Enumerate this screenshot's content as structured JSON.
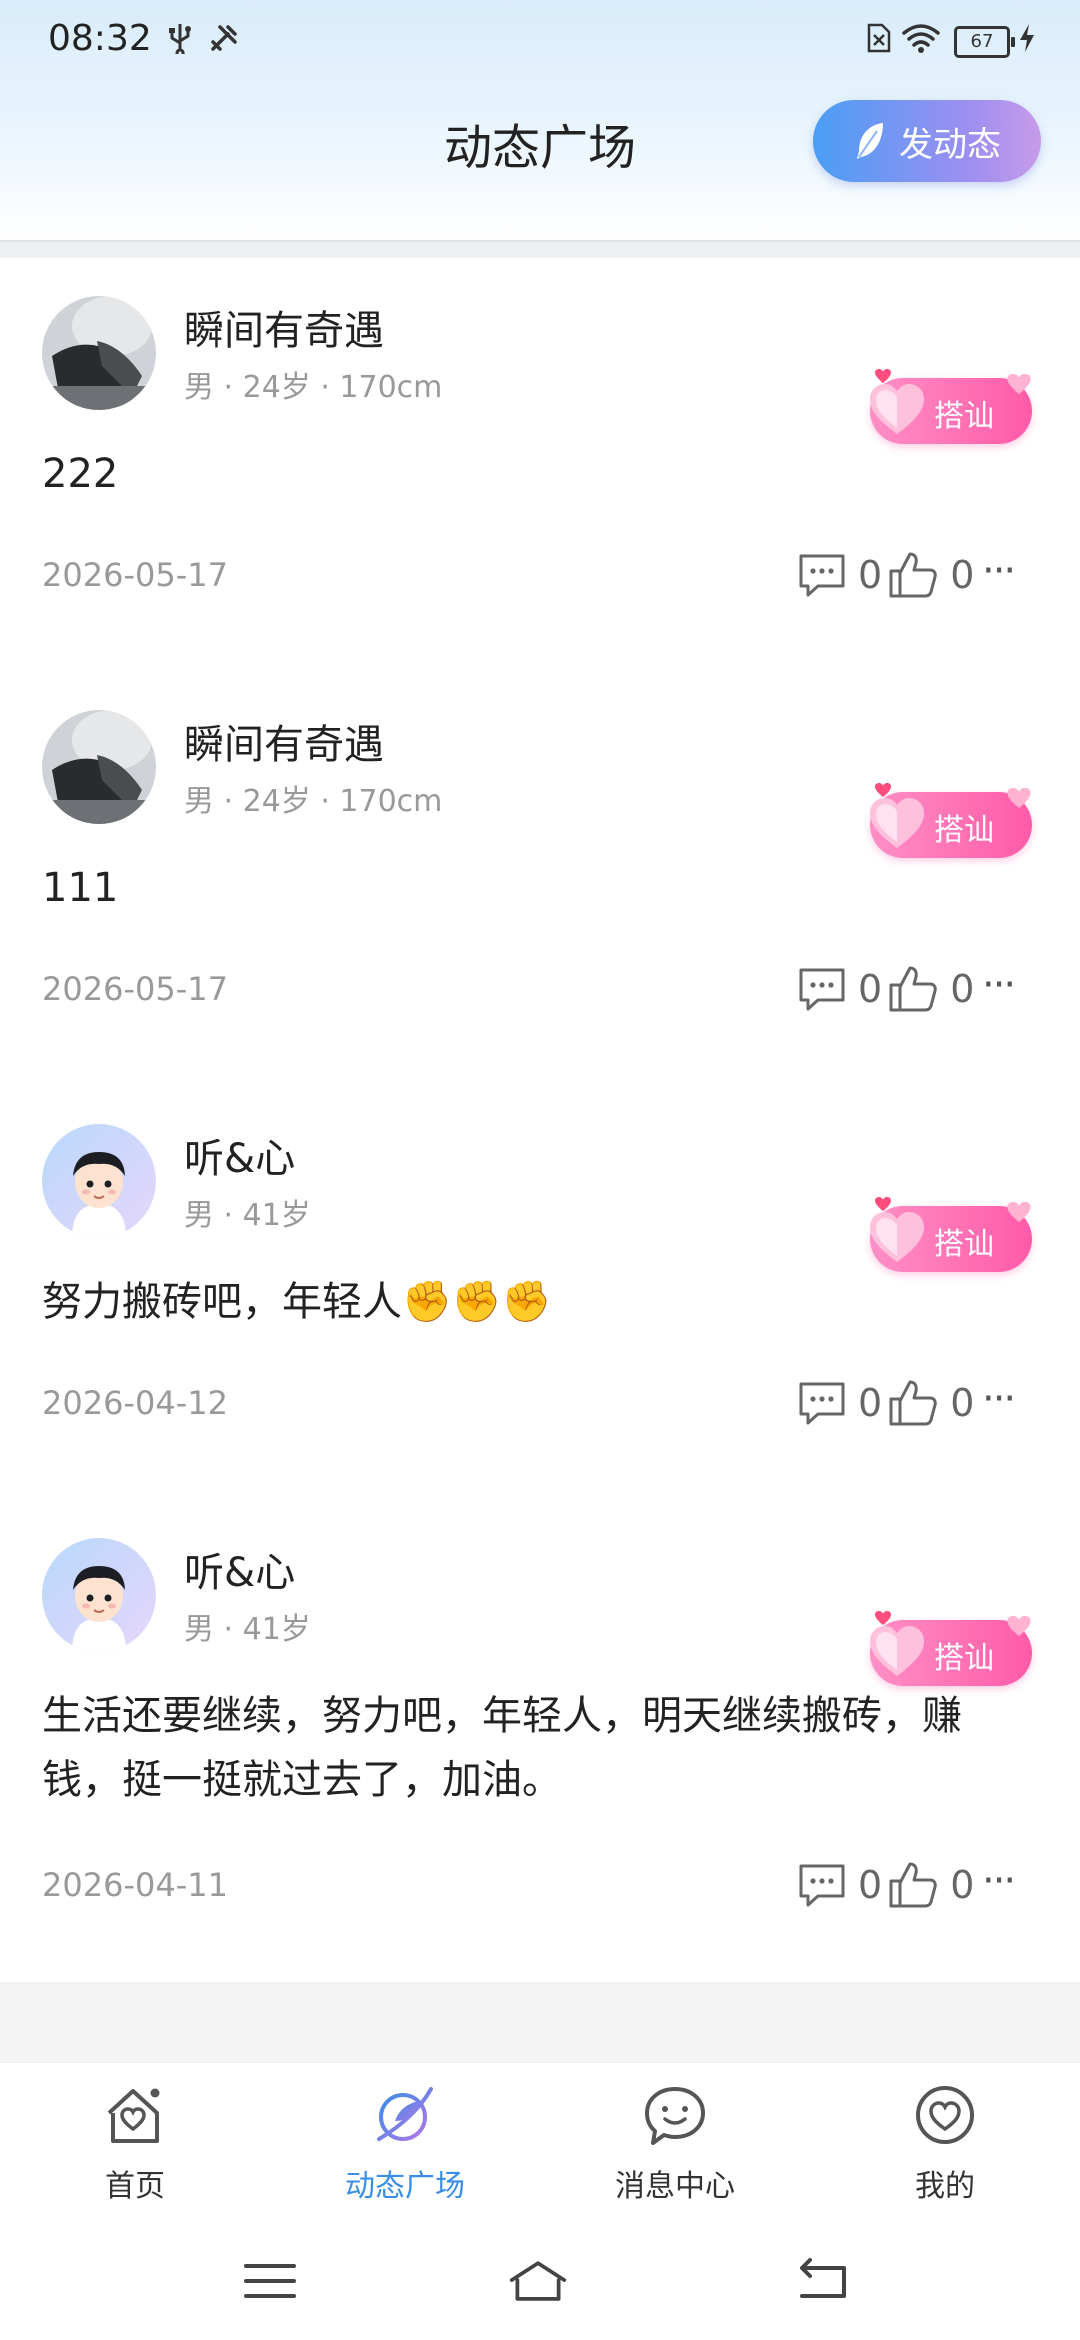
{
  "status_bar": {
    "time": "08:32",
    "battery": "67"
  },
  "header": {
    "title": "动态广场",
    "post_button": "发动态"
  },
  "posts": [
    {
      "username": "瞬间有奇遇",
      "meta": "男 · 24岁 · 170cm",
      "flirt_label": "搭讪",
      "content": "222",
      "date": "2026-05-17",
      "comments": "0",
      "likes": "0"
    },
    {
      "username": "瞬间有奇遇",
      "meta": "男 · 24岁 · 170cm",
      "flirt_label": "搭讪",
      "content": "111",
      "date": "2026-05-17",
      "comments": "0",
      "likes": "0"
    },
    {
      "username": "听&心",
      "meta": "男 · 41岁",
      "flirt_label": "搭讪",
      "content": "努力搬砖吧，年轻人✊✊✊",
      "date": "2026-04-12",
      "comments": "0",
      "likes": "0"
    },
    {
      "username": "听&心",
      "meta": "男 · 41岁",
      "flirt_label": "搭讪",
      "content": "生活还要继续，努力吧，年轻人，明天继续搬砖，赚钱，挺一挺就过去了，加油。",
      "date": "2026-04-11",
      "comments": "0",
      "likes": "0"
    }
  ],
  "tabs": [
    {
      "label": "首页",
      "icon": "home-heart-icon"
    },
    {
      "label": "动态广场",
      "icon": "feather-planet-icon",
      "active": true
    },
    {
      "label": "消息中心",
      "icon": "chat-bubble-icon"
    },
    {
      "label": "我的",
      "icon": "profile-heart-icon"
    }
  ],
  "colors": {
    "accent": "#3a8ee6",
    "flirt_pink": "#ff5aa8",
    "post_button_start": "#4a9df5",
    "post_button_end": "#c79be9"
  }
}
